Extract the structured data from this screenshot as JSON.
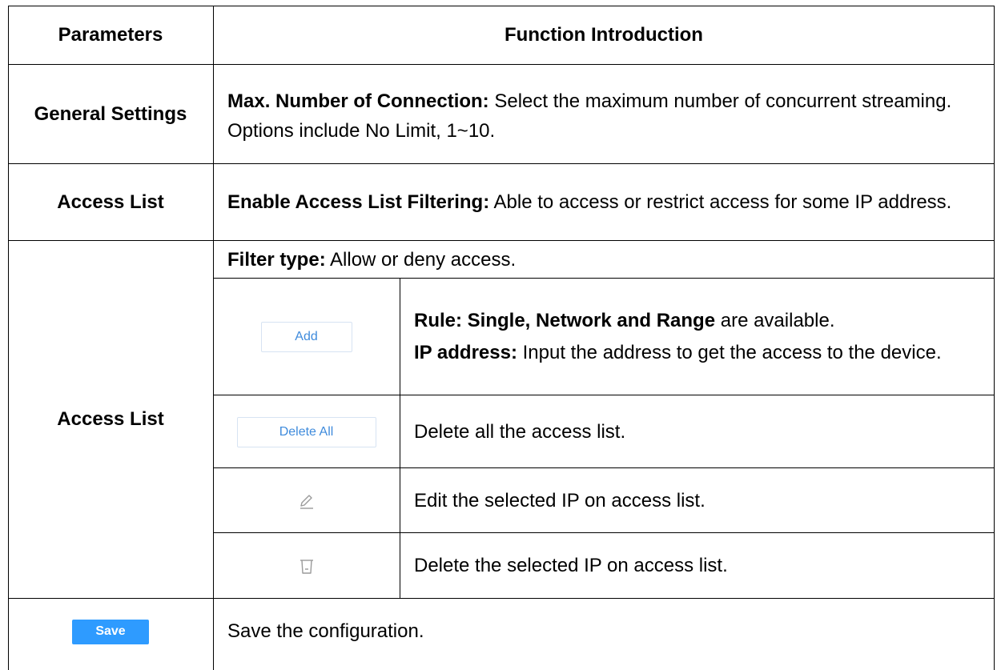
{
  "table": {
    "headers": {
      "parameters": "Parameters",
      "function": "Function Introduction"
    },
    "rows": [
      {
        "parameter": "General Settings",
        "label": "Max. Number of Connection:",
        "text": " Select the maximum number of concurrent streaming. Options include No Limit, 1~10."
      },
      {
        "parameter": "Access List",
        "label": "Enable Access List Filtering:",
        "text": " Able to access or restrict access for some IP address."
      },
      {
        "parameter": "Access List",
        "filter_label": "Filter type:",
        "filter_text": " Allow or deny access.",
        "sub_rows": [
          {
            "button_label": "Add",
            "lines": [
              {
                "bold": "Rule: Single, Network and Range",
                "text": " are available."
              },
              {
                "bold": "IP address:",
                "text": " Input the address to get the access to the device."
              }
            ]
          },
          {
            "button_label": "Delete All",
            "text": "Delete all the access list."
          },
          {
            "icon": "pencil-icon",
            "text": "Edit the selected IP on access list."
          },
          {
            "icon": "trash-icon",
            "text": "Delete the selected IP on access list."
          }
        ]
      },
      {
        "button_label": "Save",
        "text": "Save the configuration."
      }
    ],
    "colors": {
      "button_text": "#3f8bdc",
      "button_border": "#d7e3f2",
      "save_bg": "#2e9bff",
      "icon": "#9a9a9a"
    }
  }
}
